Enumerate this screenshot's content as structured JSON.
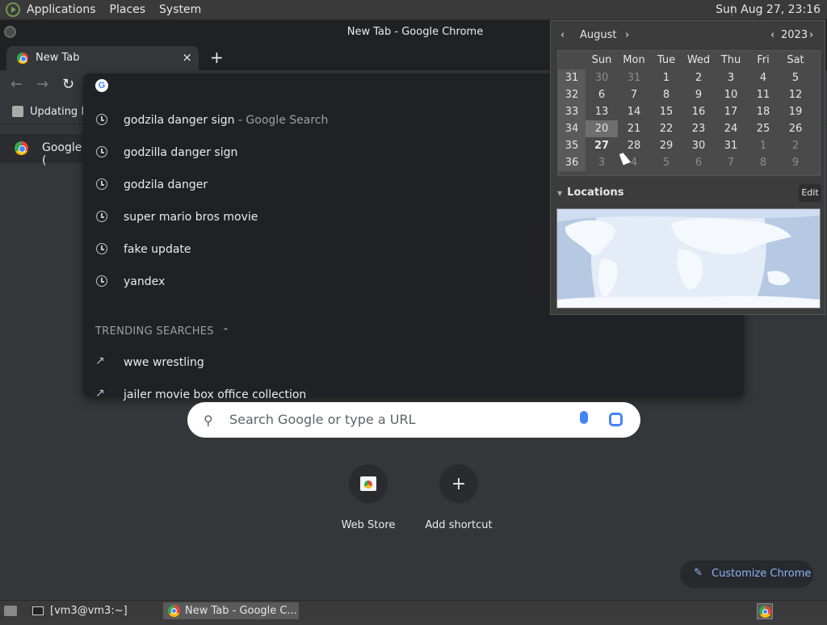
{
  "top_panel": {
    "menus": [
      "Applications",
      "Places",
      "System"
    ],
    "clock": "Sun Aug 27, 23:16"
  },
  "window": {
    "title": "New Tab - Google Chrome"
  },
  "tab": {
    "title": "New Tab",
    "close": "×"
  },
  "new_tab_label": "+",
  "bookmarks": {
    "item": "Updating P"
  },
  "side_chip": {
    "label": "Google ("
  },
  "omnibox": {
    "history": [
      {
        "text": "godzila danger sign",
        "suffix": " - Google Search"
      },
      {
        "text": "godzilla danger sign",
        "suffix": ""
      },
      {
        "text": "godzila danger",
        "suffix": ""
      },
      {
        "text": "super mario bros movie",
        "suffix": ""
      },
      {
        "text": "fake update",
        "suffix": ""
      },
      {
        "text": "yandex",
        "suffix": ""
      }
    ],
    "trending_header": "TRENDING SEARCHES",
    "trending": [
      "wwe wrestling",
      "jailer movie box office collection"
    ]
  },
  "search": {
    "placeholder": "Search Google or type a URL"
  },
  "shortcuts": [
    {
      "label": "Web Store"
    },
    {
      "label": "Add shortcut"
    }
  ],
  "customize": {
    "label": "Customize Chrome"
  },
  "calendar": {
    "month": "August",
    "year": "2023",
    "weekdays": [
      "Sun",
      "Mon",
      "Tue",
      "Wed",
      "Thu",
      "Fri",
      "Sat"
    ],
    "weeks": [
      {
        "num": "31",
        "days": [
          [
            "30",
            "other"
          ],
          [
            "31",
            "other"
          ],
          [
            "1",
            ""
          ],
          [
            "2",
            ""
          ],
          [
            "3",
            ""
          ],
          [
            "4",
            ""
          ],
          [
            "5",
            ""
          ]
        ]
      },
      {
        "num": "32",
        "days": [
          [
            "6",
            ""
          ],
          [
            "7",
            ""
          ],
          [
            "8",
            ""
          ],
          [
            "9",
            ""
          ],
          [
            "10",
            ""
          ],
          [
            "11",
            ""
          ],
          [
            "12",
            ""
          ]
        ]
      },
      {
        "num": "33",
        "days": [
          [
            "13",
            ""
          ],
          [
            "14",
            ""
          ],
          [
            "15",
            ""
          ],
          [
            "16",
            ""
          ],
          [
            "17",
            ""
          ],
          [
            "18",
            ""
          ],
          [
            "19",
            ""
          ]
        ]
      },
      {
        "num": "34",
        "days": [
          [
            "20",
            "sel"
          ],
          [
            "21",
            ""
          ],
          [
            "22",
            ""
          ],
          [
            "23",
            ""
          ],
          [
            "24",
            ""
          ],
          [
            "25",
            ""
          ],
          [
            "26",
            ""
          ]
        ]
      },
      {
        "num": "35",
        "days": [
          [
            "27",
            "today"
          ],
          [
            "28",
            ""
          ],
          [
            "29",
            ""
          ],
          [
            "30",
            ""
          ],
          [
            "31",
            ""
          ],
          [
            "1",
            "other"
          ],
          [
            "2",
            "other"
          ]
        ]
      },
      {
        "num": "36",
        "days": [
          [
            "3",
            "other"
          ],
          [
            "4",
            "other"
          ],
          [
            "5",
            "other"
          ],
          [
            "6",
            "other"
          ],
          [
            "7",
            "other"
          ],
          [
            "8",
            "other"
          ],
          [
            "9",
            "other"
          ]
        ]
      }
    ],
    "locations_label": "Locations",
    "edit_label": "Edit"
  },
  "taskbar": {
    "items": [
      "[vm3@vm3:~]",
      "New Tab - Google C..."
    ]
  },
  "colors": {
    "accent_blue": "#8ab4f8",
    "panel": "#3a3a3a",
    "chrome_bg": "#35363a",
    "dropdown_bg": "#202124"
  }
}
